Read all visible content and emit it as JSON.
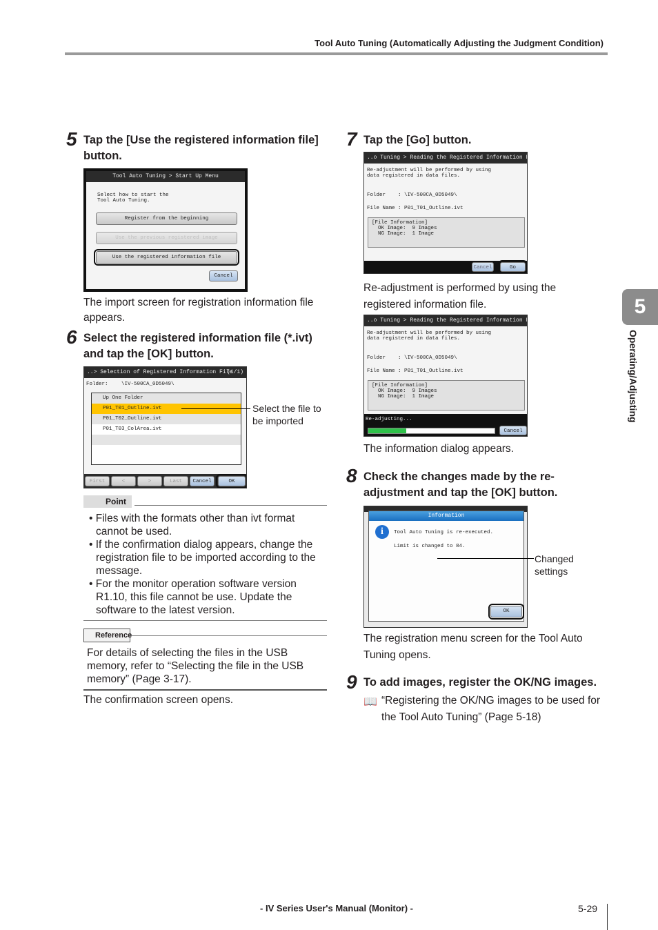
{
  "header": {
    "title": "Tool Auto Tuning (Automatically Adjusting the Judgment Condition)"
  },
  "side_tab": {
    "number": "5",
    "label": "Operating/Adjusting"
  },
  "steps": [
    {
      "num": "5",
      "title": "Tap the [Use the registered information file] button.",
      "result": "The import screen for registration information file appears."
    },
    {
      "num": "6",
      "title": "Select the registered information file (*.ivt) and tap the [OK] button.",
      "callout": "Select the file to be imported",
      "result": "The confirmation screen opens."
    },
    {
      "num": "7",
      "title": "Tap the [Go] button.",
      "result": "Re-adjustment is performed by using the registered information file.",
      "result2": "The information dialog appears."
    },
    {
      "num": "8",
      "title": "Check the changes made by the re-adjustment and tap the [OK] button.",
      "callout": "Changed settings",
      "result": "The registration menu screen for the Tool Auto Tuning opens."
    },
    {
      "num": "9",
      "title": "To add images, register the OK/NG images.",
      "ref": "“Registering the OK/NG images to be used for the Tool Auto Tuning” (Page 5-18)"
    }
  ],
  "screen_startup": {
    "title": "Tool Auto Tuning > Start Up Menu",
    "prompt": "Select how to start the\nTool Auto Tuning.",
    "buttons": [
      "Register from the beginning",
      "Use the previous registered image",
      "Use the registered information file"
    ],
    "cancel": "Cancel"
  },
  "screen_select": {
    "title": "..> Selection of Registered Information File",
    "page": "(1/1)",
    "folder_label": "Folder:",
    "folder": "\\IV-500CA_0D5049\\",
    "items": [
      "Up One Folder",
      "P01_T01_Outline.ivt",
      "P01_T02_Outline.ivt",
      "P01_T03_ColArea.ivt"
    ],
    "selected": 1,
    "buttons": [
      "First",
      "<",
      ">",
      "Last",
      "Cancel",
      "OK"
    ]
  },
  "screen_reading": {
    "title": "..o Tuning > Reading the Registered Information File",
    "msg": "Re-adjustment will be performed by using\ndata registered in data files.",
    "folder": "Folder    : \\IV-500CA_0D5049\\",
    "file": "File Name : P01_T01_Outline.ivt",
    "info": "[File Information]\n  OK Image:  9 Images\n  NG Image:  1 Image",
    "cancel": "Cancel",
    "go": "Go",
    "progress_label": "Re-adjusting...",
    "progress": 0.3
  },
  "screen_info": {
    "title": "Information",
    "line1": "Tool Auto Tuning is re-executed.",
    "line2": "Limit is changed to 84.",
    "ok": "OK",
    "icon": "info-icon"
  },
  "point": {
    "label": "Point",
    "bullets": [
      "Files with the formats other than ivt format cannot be used.",
      "If the confirmation dialog appears, change the registration file to be imported according to the message.",
      "For the monitor operation software version R1.10, this file cannot be use. Update the software to the latest version."
    ]
  },
  "reference": {
    "label": "Reference",
    "text": "For details of selecting the files in the USB memory, refer to “Selecting the file in the USB memory” (Page 3-17)."
  },
  "footer": {
    "title": "- IV Series User's Manual (Monitor) -",
    "page": "5-29"
  }
}
